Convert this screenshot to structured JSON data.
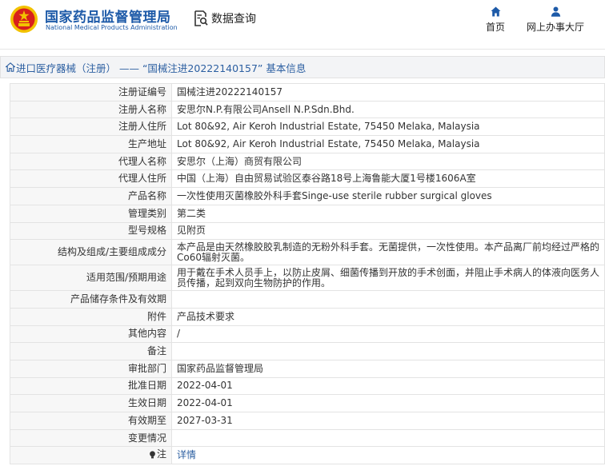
{
  "header": {
    "brand_cn": "国家药品监督管理局",
    "brand_en": "National Medical Products Administration",
    "query_label": "数据查询",
    "nav": {
      "home_label": "首页",
      "office_label": "网上办事大厅"
    }
  },
  "title_bar": {
    "text": "进口医疗器械（注册） —— “国械注进20222140157” 基本信息"
  },
  "rows": [
    {
      "label": "注册证编号",
      "value": "国械注进20222140157"
    },
    {
      "label": "注册人名称",
      "value": "安思尔N.P.有限公司Ansell N.P.Sdn.Bhd."
    },
    {
      "label": "注册人住所",
      "value": "Lot 80&92, Air Keroh Industrial Estate, 75450 Melaka, Malaysia"
    },
    {
      "label": "生产地址",
      "value": "Lot 80&92, Air Keroh Industrial Estate, 75450 Melaka, Malaysia"
    },
    {
      "label": "代理人名称",
      "value": "安思尔（上海）商贸有限公司"
    },
    {
      "label": "代理人住所",
      "value": "中国（上海）自由贸易试验区泰谷路18号上海鲁能大厦1号楼1606A室"
    },
    {
      "label": "产品名称",
      "value": "一次性使用灭菌橡胶外科手套Singe-use sterile rubber surgical gloves"
    },
    {
      "label": "管理类别",
      "value": "第二类"
    },
    {
      "label": "型号规格",
      "value": "见附页"
    },
    {
      "label": "结构及组成/主要组成成分",
      "value": "本产品是由天然橡胶胶乳制造的无粉外科手套。无菌提供，一次性使用。本产品离厂前均经过严格的Co60辐射灭菌。"
    },
    {
      "label": "适用范围/预期用途",
      "value": "用于戴在手术人员手上，以防止皮屑、细菌传播到开放的手术创面，并阻止手术病人的体液向医务人员传播，起到双向生物防护的作用。"
    },
    {
      "label": "产品储存条件及有效期",
      "value": ""
    },
    {
      "label": "附件",
      "value": "产品技术要求"
    },
    {
      "label": "其他内容",
      "value": "/"
    },
    {
      "label": "备注",
      "value": ""
    },
    {
      "label": "审批部门",
      "value": "国家药品监督管理局"
    },
    {
      "label": "批准日期",
      "value": "2022-04-01"
    },
    {
      "label": "生效日期",
      "value": "2022-04-01"
    },
    {
      "label": "有效期至",
      "value": "2027-03-31"
    },
    {
      "label": "变更情况",
      "value": ""
    }
  ],
  "note": {
    "label": "注",
    "link": "详情"
  },
  "colors": {
    "brand_blue": "#1d5aa8",
    "link_blue": "#2c5fa1",
    "emblem_red": "#d8201c",
    "emblem_gold": "#f2c200"
  },
  "icons": {
    "logo": "national-emblem-icon",
    "query": "document-search-icon",
    "home": "home-icon",
    "office": "person-icon",
    "title": "home-icon",
    "note": "lightbulb-icon"
  }
}
